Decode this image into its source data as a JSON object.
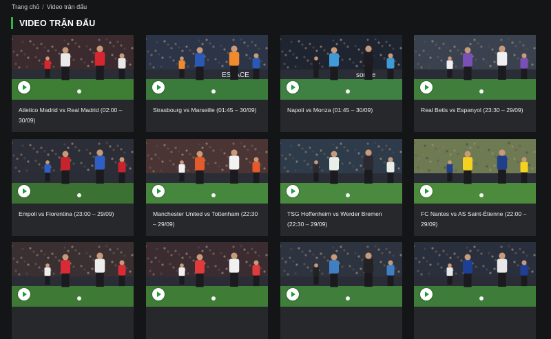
{
  "breadcrumb": {
    "home": "Trang chủ",
    "separator": "/",
    "current": "Video trận đấu"
  },
  "section": {
    "title": "VIDEO TRẬN ĐẤU"
  },
  "colors": {
    "accent": "#2fb34a",
    "background": "#141517",
    "card": "#26282b"
  },
  "icons": {
    "play": "play-icon"
  },
  "videos": [
    {
      "title": "Atletico Madrid vs Real Madrid (02:00 – 30/09)",
      "sky": "#3b2a2e",
      "pitch": "#3e7d34",
      "kitA": "#e9e9e9",
      "kitB": "#d7262f"
    },
    {
      "title": "Strasbourg vs Marseille (01:45 – 30/09)",
      "sky": "#2c3448",
      "pitch": "#3a7a3a",
      "kitA": "#2a58b5",
      "kitB": "#f08a2c",
      "boards": "ESPACE"
    },
    {
      "title": "Napoli vs Monza (01:45 – 30/09)",
      "sky": "#1e2430",
      "pitch": "#3f8142",
      "kitA": "#3f9ad8",
      "kitB": "#1c1c22",
      "boards": "sorare"
    },
    {
      "title": "Real Betis vs Espanyol (23:30 – 29/09)",
      "sky": "#3a4250",
      "pitch": "#3f7f3b",
      "kitA": "#7a4fb6",
      "kitB": "#f0f0f0"
    },
    {
      "title": "Empoli vs Fiorentina (23:00 – 29/09)",
      "sky": "#2b2e37",
      "pitch": "#3b7233",
      "kitA": "#c8232d",
      "kitB": "#2f5fc4"
    },
    {
      "title": "Manchester United vs Tottenham (22:30 – 29/09)",
      "sky": "#4a3434",
      "pitch": "#45873d",
      "kitA": "#e45a2a",
      "kitB": "#f2f2f2"
    },
    {
      "title": "TSG Hoffenheim vs Werder Bremen (22:30 – 29/09)",
      "sky": "#2e3b4a",
      "pitch": "#4a8a3f",
      "kitA": "#e8efe8",
      "kitB": "#2a2a30"
    },
    {
      "title": "FC Nantes vs AS Saint-Étienne (22:00 – 29/09)",
      "sky": "#6d7a52",
      "pitch": "#4c8a3c",
      "kitA": "#f4d21f",
      "kitB": "#1f3f8a"
    },
    {
      "title": "",
      "sky": "#3a3032",
      "pitch": "#3e7a35",
      "kitA": "#d92a35",
      "kitB": "#ededed"
    },
    {
      "title": "",
      "sky": "#3a2c30",
      "pitch": "#3f7d37",
      "kitA": "#e03a3a",
      "kitB": "#f0f0f0"
    },
    {
      "title": "",
      "sky": "#2d3440",
      "pitch": "#3f7e3b",
      "kitA": "#3f7fc4",
      "kitB": "#222"
    },
    {
      "title": "",
      "sky": "#2a2f3d",
      "pitch": "#3d7c39",
      "kitA": "#1d3f95",
      "kitB": "#e8e8e8"
    }
  ]
}
